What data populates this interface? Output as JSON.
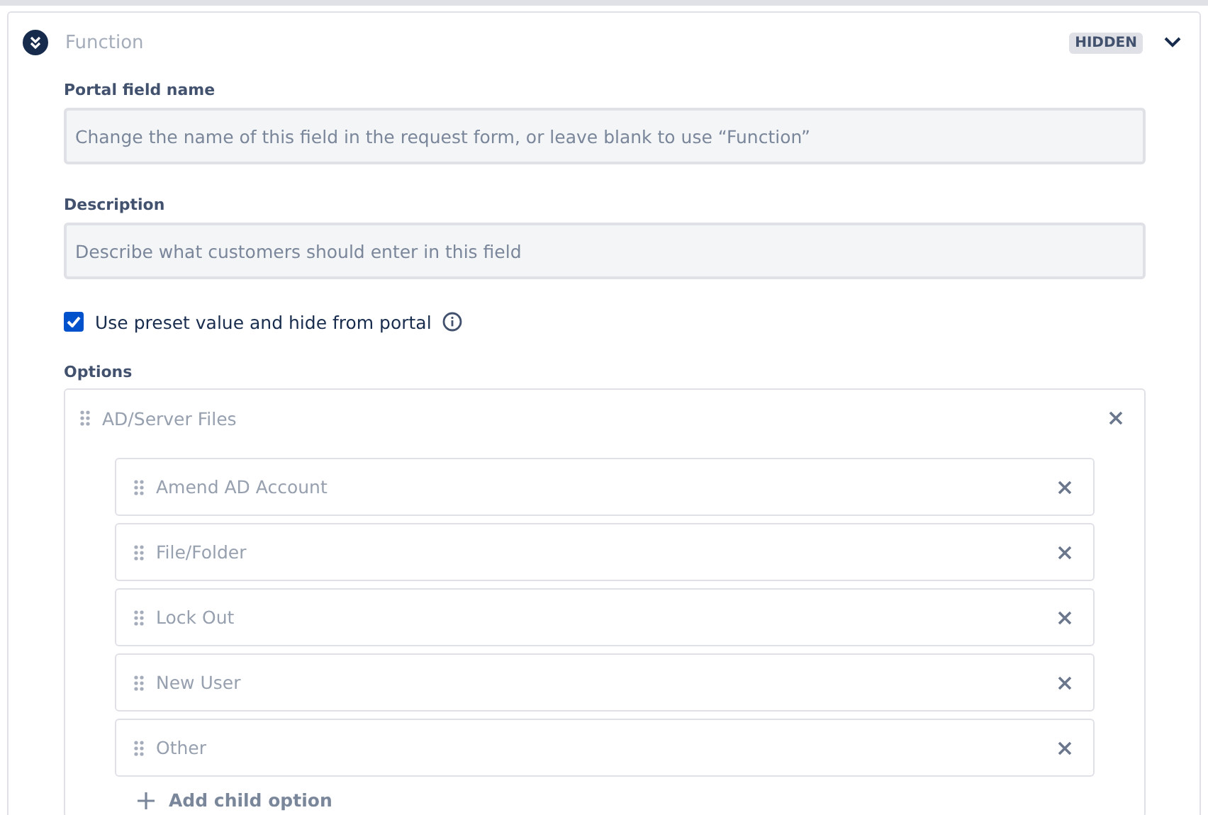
{
  "field": {
    "title": "Function",
    "badge": "HIDDEN",
    "expanded": true
  },
  "portal_field_name": {
    "label": "Portal field name",
    "placeholder": "Change the name of this field in the request form, or leave blank to use “Function”"
  },
  "description": {
    "label": "Description",
    "placeholder": "Describe what customers should enter in this field"
  },
  "preset": {
    "label": "Use preset value and hide from portal",
    "checked": true
  },
  "options": {
    "label": "Options",
    "parent": "AD/Server Files",
    "children": [
      {
        "label": "Amend AD Account"
      },
      {
        "label": "File/Folder"
      },
      {
        "label": "Lock Out"
      },
      {
        "label": "New User"
      },
      {
        "label": "Other"
      }
    ],
    "add_label": "Add child option"
  }
}
